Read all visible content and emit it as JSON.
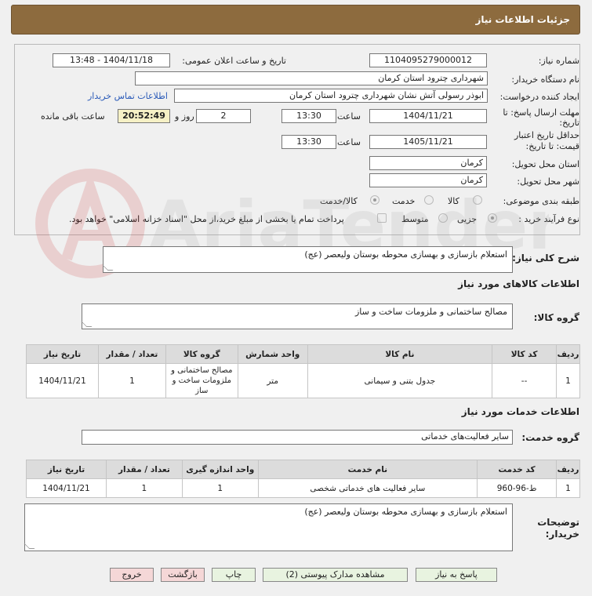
{
  "header": {
    "title": "جزئیات اطلاعات نیاز"
  },
  "fields": {
    "need_number_label": "شماره نیاز:",
    "need_number": "1104095279000012",
    "announce_label": "تاریخ و ساعت اعلان عمومی:",
    "announce_value": "1404/11/18 - 13:48",
    "buyer_label": "نام دستگاه خریدار:",
    "buyer_value": "شهرداری چترود استان کرمان",
    "creator_label": "ایجاد کننده درخواست:",
    "creator_value": "ابوذر رسولی آتش نشان شهرداری چترود استان کرمان",
    "contact_link": "اطلاعات تماس خریدار",
    "deadline_label_1": "مهلت ارسال پاسخ: تا",
    "deadline_label_2": "تاریخ:",
    "deadline_date": "1404/11/21",
    "time_label": "ساعت",
    "deadline_time": "13:30",
    "days_value": "2",
    "days_label": "روز و",
    "remaining_time": "20:52:49",
    "remaining_label": "ساعت باقی مانده",
    "validity_label_1": "حداقل تاریخ اعتبار",
    "validity_label_2": "قیمت: تا تاریخ:",
    "validity_date": "1405/11/21",
    "validity_time": "13:30",
    "province_label": "استان محل تحویل:",
    "province_value": "کرمان",
    "city_label": "شهر محل تحویل:",
    "city_value": "کرمان",
    "category_label": "طبقه بندی موضوعی:",
    "category_options": [
      "کالا",
      "خدمت",
      "کالا/خدمت"
    ],
    "purchase_label": "نوع فرآیند خرید :",
    "purchase_options": [
      "جزیی",
      "متوسط"
    ],
    "payment_note": "پرداخت تمام یا بخشی از مبلغ خرید،از محل \"اسناد خزانه اسلامی\" خواهد بود."
  },
  "description": {
    "label": "شرح کلی نیاز:",
    "value": "استعلام بازسازی و بهسازی محوطه بوستان ولیعصر (عج)"
  },
  "goods": {
    "section_title": "اطلاعات کالاهای مورد نیاز",
    "group_label": "گروه کالا:",
    "group_value": "مصالح ساختمانی و ملزومات ساخت و ساز",
    "columns": [
      "ردیف",
      "کد کالا",
      "نام کالا",
      "واحد شمارش",
      "گروه کالا",
      "تعداد / مقدار",
      "تاریخ نیاز"
    ],
    "rows": [
      [
        "1",
        "--",
        "جدول بتنی و سیمانی",
        "متر",
        "مصالح ساختمانی و ملزومات ساخت و ساز",
        "1",
        "1404/11/21"
      ]
    ]
  },
  "services": {
    "section_title": "اطلاعات خدمات مورد نیاز",
    "group_label": "گروه خدمت:",
    "group_value": "سایر فعالیت‌های خدماتی",
    "columns": [
      "ردیف",
      "کد خدمت",
      "نام خدمت",
      "واحد اندازه گیری",
      "تعداد / مقدار",
      "تاریخ نیاز"
    ],
    "rows": [
      [
        "1",
        "ط-96-960",
        "سایر فعالیت های خدماتی شخصی",
        "1",
        "1",
        "1404/11/21"
      ]
    ]
  },
  "buyer_notes": {
    "label_1": "توضیحات",
    "label_2": "خریدار:",
    "value": "استعلام بازسازی و بهسازی محوطه بوستان ولیعصر (عج)"
  },
  "buttons": {
    "reply": "پاسخ به نیاز",
    "attachments": "مشاهده مدارک پیوستی (2)",
    "print": "چاپ",
    "back": "بازگشت",
    "exit": "خروج"
  },
  "watermark": {
    "text": "AriaTender.neT"
  },
  "colors": {
    "header": "#8d6b3e",
    "remaining_bg": "#f6f1c6",
    "button_green": "#e8f3e0",
    "button_red": "#f5d7d7",
    "link": "#2a5ab8"
  }
}
